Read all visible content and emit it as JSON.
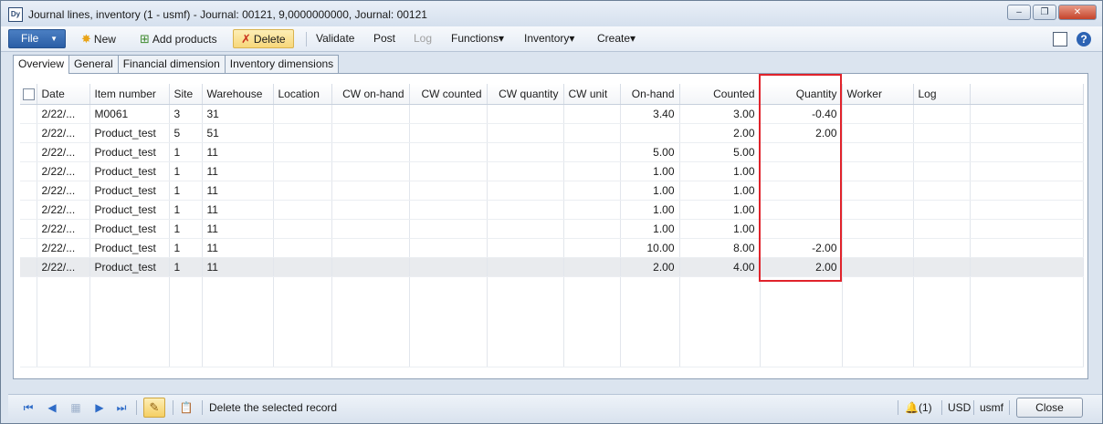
{
  "window": {
    "title": "Journal lines, inventory (1 - usmf) - Journal: 00121, 9,0000000000, Journal: 00121",
    "app_icon_text": "Dy",
    "minimize_glyph": "–",
    "restore_glyph": "❐",
    "close_glyph": "✕"
  },
  "actionpane": {
    "file_label": "File",
    "file_arrow": "▼",
    "new_label": "New",
    "add_products_label": "Add products",
    "delete_label": "Delete",
    "validate_label": "Validate",
    "post_label": "Post",
    "log_label": "Log",
    "functions_label": "Functions▾",
    "inventory_label": "Inventory▾",
    "create_label": "Create▾",
    "new_icon": "✸",
    "add_icon": "⊞",
    "delete_icon": "✗",
    "help_glyph": "?"
  },
  "tabs": [
    {
      "label": "Overview"
    },
    {
      "label": "General"
    },
    {
      "label": "Financial dimension"
    },
    {
      "label": "Inventory dimensions"
    }
  ],
  "grid": {
    "columns": [
      "Date",
      "Item number",
      "Site",
      "Warehouse",
      "Location",
      "CW on-hand",
      "CW counted",
      "CW quantity",
      "CW unit",
      "On-hand",
      "Counted",
      "Quantity",
      "Worker",
      "Log"
    ],
    "rows": [
      {
        "date": "2/22/...",
        "item": "M0061",
        "site": "3",
        "warehouse": "31",
        "onhand": "3.40",
        "counted": "3.00",
        "quantity": "-0.40"
      },
      {
        "date": "2/22/...",
        "item": "Product_test",
        "site": "5",
        "warehouse": "51",
        "onhand": "",
        "counted": "2.00",
        "quantity": "2.00"
      },
      {
        "date": "2/22/...",
        "item": "Product_test",
        "site": "1",
        "warehouse": "11",
        "onhand": "5.00",
        "counted": "5.00",
        "quantity": ""
      },
      {
        "date": "2/22/...",
        "item": "Product_test",
        "site": "1",
        "warehouse": "11",
        "onhand": "1.00",
        "counted": "1.00",
        "quantity": ""
      },
      {
        "date": "2/22/...",
        "item": "Product_test",
        "site": "1",
        "warehouse": "11",
        "onhand": "1.00",
        "counted": "1.00",
        "quantity": ""
      },
      {
        "date": "2/22/...",
        "item": "Product_test",
        "site": "1",
        "warehouse": "11",
        "onhand": "1.00",
        "counted": "1.00",
        "quantity": ""
      },
      {
        "date": "2/22/...",
        "item": "Product_test",
        "site": "1",
        "warehouse": "11",
        "onhand": "1.00",
        "counted": "1.00",
        "quantity": ""
      },
      {
        "date": "2/22/...",
        "item": "Product_test",
        "site": "1",
        "warehouse": "11",
        "onhand": "10.00",
        "counted": "8.00",
        "quantity": "-2.00"
      },
      {
        "date": "2/22/...",
        "item": "Product_test",
        "site": "1",
        "warehouse": "11",
        "onhand": "2.00",
        "counted": "4.00",
        "quantity": "2.00"
      }
    ],
    "selected_row_index": 8
  },
  "statusbar": {
    "first_glyph": "⏮",
    "prev_glyph": "◀",
    "grid_glyph": "▦",
    "next_glyph": "▶",
    "last_glyph": "⏭",
    "edit_glyph": "✎",
    "attach_glyph": "📋",
    "message": "Delete the selected record",
    "notifications": "(1)",
    "bell_glyph": "🔔",
    "currency": "USD",
    "company": "usmf",
    "close_label": "Close"
  },
  "colors": {
    "highlight": "#e0232b",
    "file_button": "#2a5ea6",
    "delete_button": "#f7d77a"
  }
}
